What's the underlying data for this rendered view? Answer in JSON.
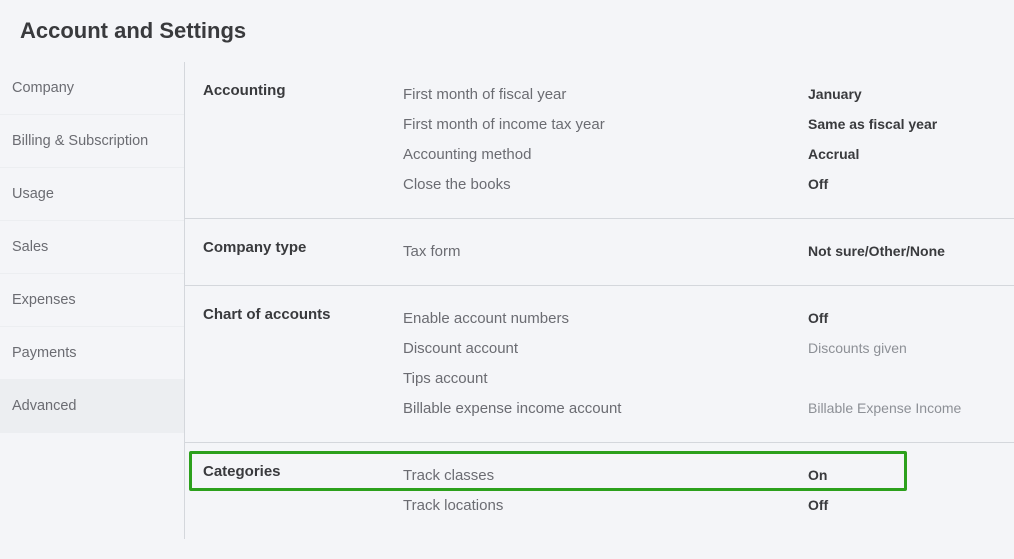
{
  "pageTitle": "Account and Settings",
  "sidebar": {
    "items": [
      {
        "label": "Company",
        "active": false
      },
      {
        "label": "Billing & Subscription",
        "active": false
      },
      {
        "label": "Usage",
        "active": false
      },
      {
        "label": "Sales",
        "active": false
      },
      {
        "label": "Expenses",
        "active": false
      },
      {
        "label": "Payments",
        "active": false
      },
      {
        "label": "Advanced",
        "active": true
      }
    ]
  },
  "sections": {
    "accounting": {
      "title": "Accounting",
      "rows": [
        {
          "label": "First month of fiscal year",
          "value": "January"
        },
        {
          "label": "First month of income tax year",
          "value": "Same as fiscal year"
        },
        {
          "label": "Accounting method",
          "value": "Accrual"
        },
        {
          "label": "Close the books",
          "value": "Off"
        }
      ]
    },
    "companyType": {
      "title": "Company type",
      "rows": [
        {
          "label": "Tax form",
          "value": "Not sure/Other/None"
        }
      ]
    },
    "chartOfAccounts": {
      "title": "Chart of accounts",
      "rows": [
        {
          "label": "Enable account numbers",
          "value": "Off"
        },
        {
          "label": "Discount account",
          "value": "Discounts given",
          "muted": true
        },
        {
          "label": "Tips account",
          "value": ""
        },
        {
          "label": "Billable expense income account",
          "value": "Billable Expense Income",
          "muted": true
        }
      ]
    },
    "categories": {
      "title": "Categories",
      "rows": [
        {
          "label": "Track classes",
          "value": "On"
        },
        {
          "label": "Track locations",
          "value": "Off"
        }
      ]
    }
  }
}
